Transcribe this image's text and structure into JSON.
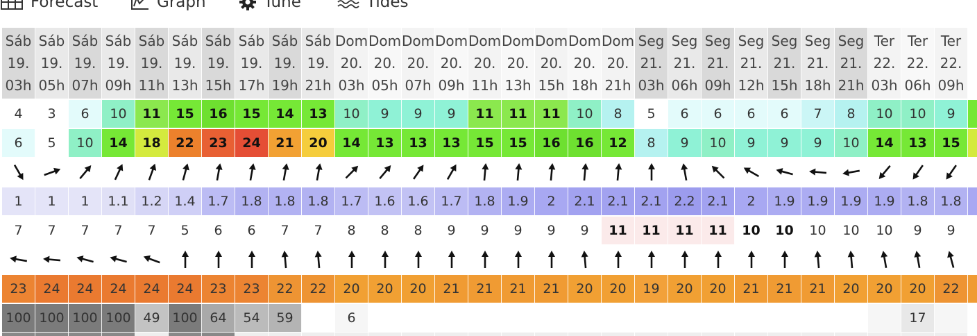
{
  "tabs": [
    {
      "name": "tab-forecast",
      "icon": "table-icon",
      "label": "Forecast"
    },
    {
      "name": "tab-graph",
      "icon": "graph-icon",
      "label": "Graph"
    },
    {
      "name": "tab-tune",
      "icon": "gear-icon",
      "label": "Tune"
    },
    {
      "name": "tab-tides",
      "icon": "waves-icon",
      "label": "Tides"
    }
  ],
  "days": [
    "Sáb",
    "Sáb",
    "Sáb",
    "Sáb",
    "Sáb",
    "Sáb",
    "Sáb",
    "Sáb",
    "Sáb",
    "Sáb",
    "Dom",
    "Dom",
    "Dom",
    "Dom",
    "Dom",
    "Dom",
    "Dom",
    "Dom",
    "Dom",
    "Seg",
    "Seg",
    "Seg",
    "Seg",
    "Seg",
    "Seg",
    "Seg",
    "Ter",
    "Ter",
    "Ter"
  ],
  "dates": [
    "19.",
    "19.",
    "19.",
    "19.",
    "19.",
    "19.",
    "19.",
    "19.",
    "19.",
    "19.",
    "20.",
    "20.",
    "20.",
    "20.",
    "20.",
    "20.",
    "20.",
    "20.",
    "20.",
    "21.",
    "21.",
    "21.",
    "21.",
    "21.",
    "21.",
    "21.",
    "22.",
    "22.",
    "22."
  ],
  "hours": [
    "03h",
    "05h",
    "07h",
    "09h",
    "11h",
    "13h",
    "15h",
    "17h",
    "19h",
    "21h",
    "03h",
    "05h",
    "07h",
    "09h",
    "11h",
    "13h",
    "15h",
    "18h",
    "21h",
    "03h",
    "06h",
    "09h",
    "12h",
    "15h",
    "18h",
    "21h",
    "03h",
    "06h",
    "09h"
  ],
  "header_shade": [
    "#d9d9d9",
    "#e9e9e9",
    "#d9d9d9",
    "#e9e9e9",
    "#d9d9d9",
    "#e9e9e9",
    "#d9d9d9",
    "#e9e9e9",
    "#d9d9d9",
    "#e9e9e9",
    "#f3f3f3",
    "#f8f8f8",
    "#f3f3f3",
    "#f8f8f8",
    "#f3f3f3",
    "#f8f8f8",
    "#f3f3f3",
    "#f8f8f8",
    "#f3f3f3",
    "#d9d9d9",
    "#e9e9e9",
    "#d9d9d9",
    "#e9e9e9",
    "#d9d9d9",
    "#e9e9e9",
    "#d9d9d9",
    "#f3f3f3",
    "#f8f8f8",
    "#f3f3f3"
  ],
  "wind_speed": [
    "4",
    "3",
    "6",
    "10",
    "11",
    "15",
    "16",
    "15",
    "14",
    "13",
    "10",
    "9",
    "9",
    "9",
    "11",
    "11",
    "11",
    "10",
    "8",
    "5",
    "6",
    "6",
    "6",
    "6",
    "7",
    "8",
    "10",
    "10",
    "9"
  ],
  "wind_gusts": [
    "6",
    "5",
    "10",
    "14",
    "18",
    "22",
    "23",
    "24",
    "21",
    "20",
    "14",
    "13",
    "13",
    "13",
    "15",
    "15",
    "16",
    "16",
    "12",
    "8",
    "9",
    "10",
    "9",
    "9",
    "9",
    "10",
    "14",
    "13",
    "15"
  ],
  "wind_dir_deg": [
    150,
    70,
    40,
    25,
    20,
    15,
    10,
    10,
    10,
    10,
    45,
    40,
    35,
    30,
    5,
    5,
    5,
    5,
    5,
    0,
    350,
    315,
    300,
    285,
    275,
    260,
    220,
    215,
    215
  ],
  "wave_height": [
    "1",
    "1",
    "1",
    "1.1",
    "1.2",
    "1.4",
    "1.7",
    "1.8",
    "1.8",
    "1.8",
    "1.7",
    "1.6",
    "1.6",
    "1.7",
    "1.8",
    "1.9",
    "2",
    "2.1",
    "2.1",
    "2.1",
    "2.2",
    "2.1",
    "2",
    "1.9",
    "1.9",
    "1.9",
    "1.9",
    "1.8",
    "1.8"
  ],
  "wave_period": [
    "7",
    "7",
    "7",
    "7",
    "7",
    "5",
    "6",
    "6",
    "7",
    "7",
    "8",
    "8",
    "8",
    "9",
    "9",
    "9",
    "9",
    "9",
    "11",
    "11",
    "11",
    "11",
    "10",
    "10",
    "10",
    "10",
    "10",
    "9",
    "9"
  ],
  "wave_dir_deg": [
    280,
    275,
    285,
    285,
    290,
    0,
    0,
    0,
    355,
    355,
    0,
    0,
    0,
    0,
    0,
    0,
    0,
    355,
    0,
    0,
    0,
    0,
    0,
    0,
    355,
    355,
    350,
    350,
    345
  ],
  "temperature": [
    "23",
    "24",
    "24",
    "24",
    "24",
    "24",
    "23",
    "23",
    "22",
    "22",
    "20",
    "20",
    "20",
    "21",
    "21",
    "21",
    "21",
    "20",
    "20",
    "19",
    "20",
    "20",
    "21",
    "21",
    "21",
    "20",
    "20",
    "20",
    "22"
  ],
  "cloud_cover": [
    "100",
    "100",
    "100",
    "100",
    "49",
    "100",
    "64",
    "54",
    "59",
    "",
    "6",
    "",
    "",
    "",
    "",
    "",
    "",
    "",
    "",
    "",
    "",
    "",
    "",
    "",
    "",
    "",
    "",
    "17",
    ""
  ],
  "colors": {
    "wind": {
      "3": "#ffffff",
      "4": "#ffffff",
      "5": "#ffffff",
      "6": "#e3fbfb",
      "7": "#cbf6f6",
      "8": "#b5f2f0",
      "9": "#8ff2d6",
      "10": "#8ff0c6",
      "11": "#8be84e",
      "12": "#76e836",
      "13": "#76e836",
      "14": "#76e836",
      "15": "#76e836",
      "16": "#6ee030",
      "18": "#d4ea3e",
      "20": "#f5cd3c",
      "21": "#f2a133",
      "22": "#ec812c",
      "23": "#e86033",
      "24": "#e54e35"
    },
    "wave": {
      "1": "#e4e4f8",
      "1.1": "#e0e0f6",
      "1.2": "#d6d6f6",
      "1.4": "#cfcff6",
      "1.6": "#c2c2f4",
      "1.7": "#bcbcf4",
      "1.8": "#b2b2f2",
      "1.9": "#acacf2",
      "2": "#a8a8f2",
      "2.1": "#a2a2f0",
      "2.2": "#9c9cee"
    },
    "period_high": "#fbeaea",
    "temp": {
      "19": "#f2a13a",
      "20": "#f1a033",
      "21": "#f09b33",
      "22": "#ee9433",
      "23": "#ec8432",
      "24": "#ea7a30"
    },
    "cloud": {
      "100": "#7b7b7b",
      "64": "#a9a9a9",
      "59": "#b4b4b4",
      "54": "#bbbbbb",
      "49": "#c3c3c3",
      "17": "#e8e8e8",
      "6": "#f6f6f6",
      "0": "#ffffff"
    }
  }
}
